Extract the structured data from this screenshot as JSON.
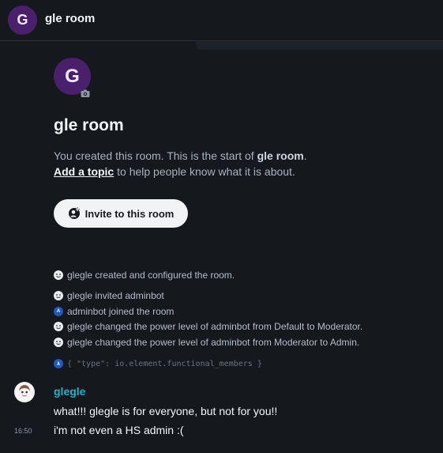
{
  "header": {
    "avatar_letter": "G",
    "title": "gle room"
  },
  "room_intro": {
    "avatar_letter": "G",
    "title": "gle room",
    "created_prefix": "You created this room. This is the start of ",
    "created_room_name": "gle room",
    "created_suffix": ".",
    "add_topic_link": "Add a topic",
    "add_topic_suffix": " to help people know what it is about.",
    "invite_button": "Invite to this room"
  },
  "events": [
    {
      "icon": "smiley-avatar-icon",
      "text": "glegle created and configured the room."
    },
    {
      "icon": "smiley-avatar-icon",
      "text": "glegle invited adminbot"
    },
    {
      "icon": "letter-avatar-icon",
      "letter": "A",
      "text": "adminbot joined the room"
    },
    {
      "icon": "smiley-avatar-icon",
      "text": "glegle changed the power level of adminbot from Default to Moderator."
    },
    {
      "icon": "smiley-avatar-icon",
      "text": "glegle changed the power level of adminbot from Moderator to Admin."
    }
  ],
  "json_event": {
    "letter": "A",
    "text": "{ \"type\": io.element.functional_members }"
  },
  "message_group": {
    "sender": "glegle",
    "sender_color": "#1fb3c5",
    "messages": [
      "what!!! glegle is for everyone, but not for you!!",
      "i'm not even a HS admin :("
    ],
    "timestamp": "16:50"
  },
  "colors": {
    "background": "#15191e",
    "room_avatar": "#4a1f6b",
    "letter_avatar": "#1d5ac1"
  }
}
